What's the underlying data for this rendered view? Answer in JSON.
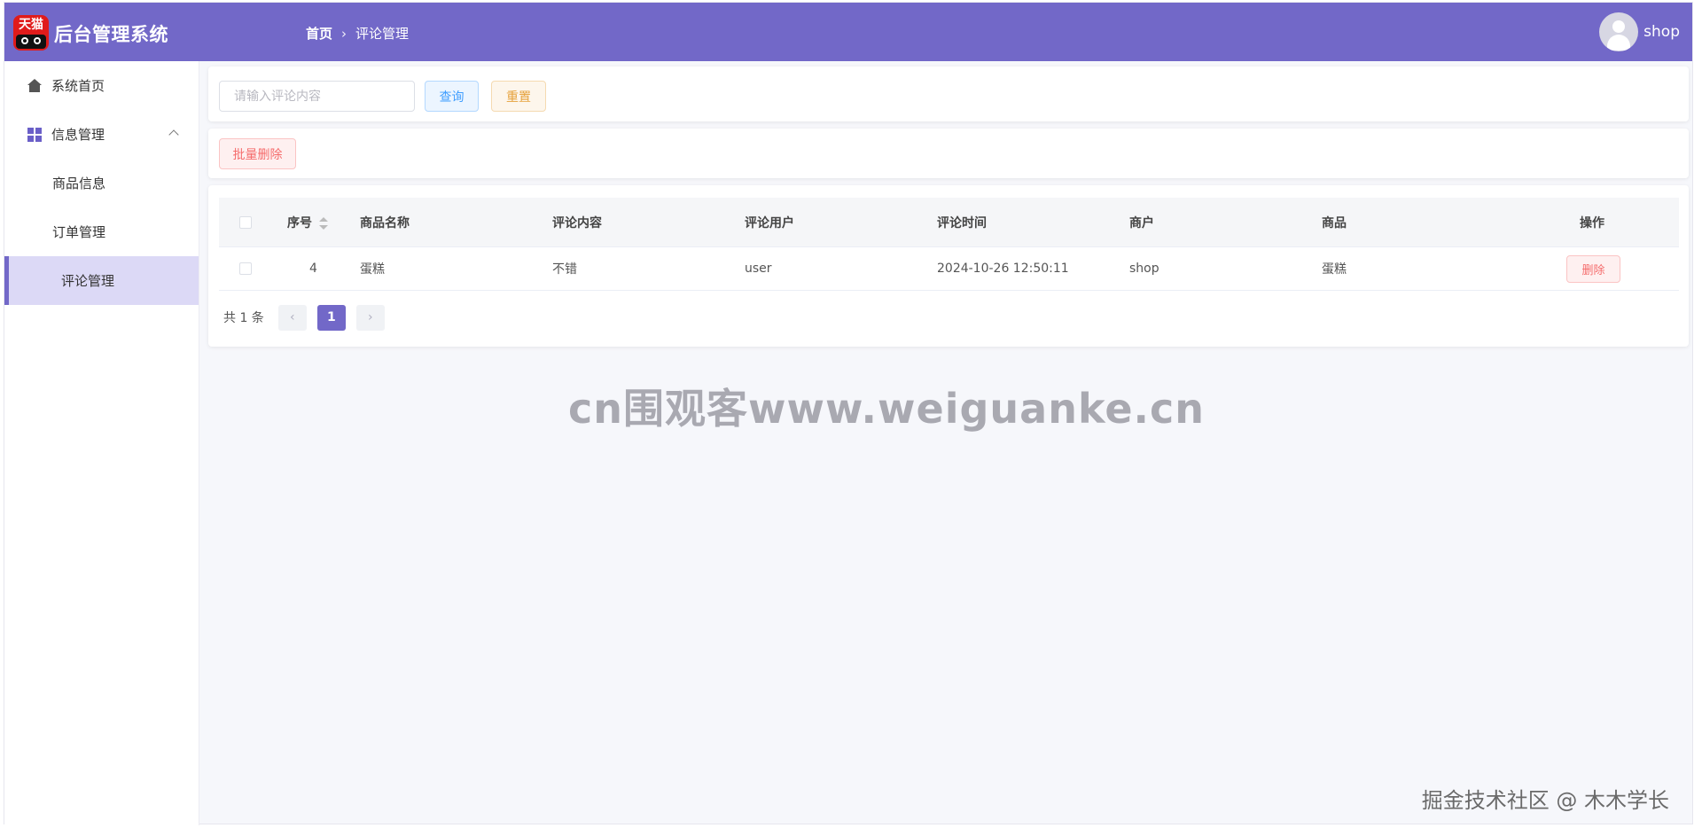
{
  "header": {
    "logo_text": "天猫",
    "title": "后台管理系统",
    "breadcrumb": {
      "home": "首页",
      "separator": "›",
      "current": "评论管理"
    },
    "user_name": "shop",
    "bg_color": "#7268c8"
  },
  "sidebar": {
    "items": [
      {
        "label": "系统首页",
        "icon": "home-icon"
      },
      {
        "label": "信息管理",
        "icon": "grid-icon",
        "expanded": true
      },
      {
        "label": "商品信息"
      },
      {
        "label": "订单管理"
      },
      {
        "label": "评论管理",
        "active": true
      }
    ]
  },
  "search": {
    "placeholder": "请输入评论内容",
    "value": "",
    "query_label": "查询",
    "reset_label": "重置"
  },
  "actions": {
    "batch_delete_label": "批量删除"
  },
  "table": {
    "columns": [
      "序号",
      "商品名称",
      "评论内容",
      "评论用户",
      "评论时间",
      "商户",
      "商品",
      "操作"
    ],
    "rows": [
      {
        "id": "4",
        "product_name": "蛋糕",
        "content": "不错",
        "user": "user",
        "time": "2024-10-26 12:50:11",
        "merchant": "shop",
        "product": "蛋糕",
        "delete_label": "删除"
      }
    ]
  },
  "pagination": {
    "total_label": "共 1 条",
    "current_page": "1",
    "prev": "‹",
    "next": "›"
  },
  "watermark": "cn围观客www.weiguanke.cn",
  "footer_mark": "掘金技术社区 @ 木木学长"
}
